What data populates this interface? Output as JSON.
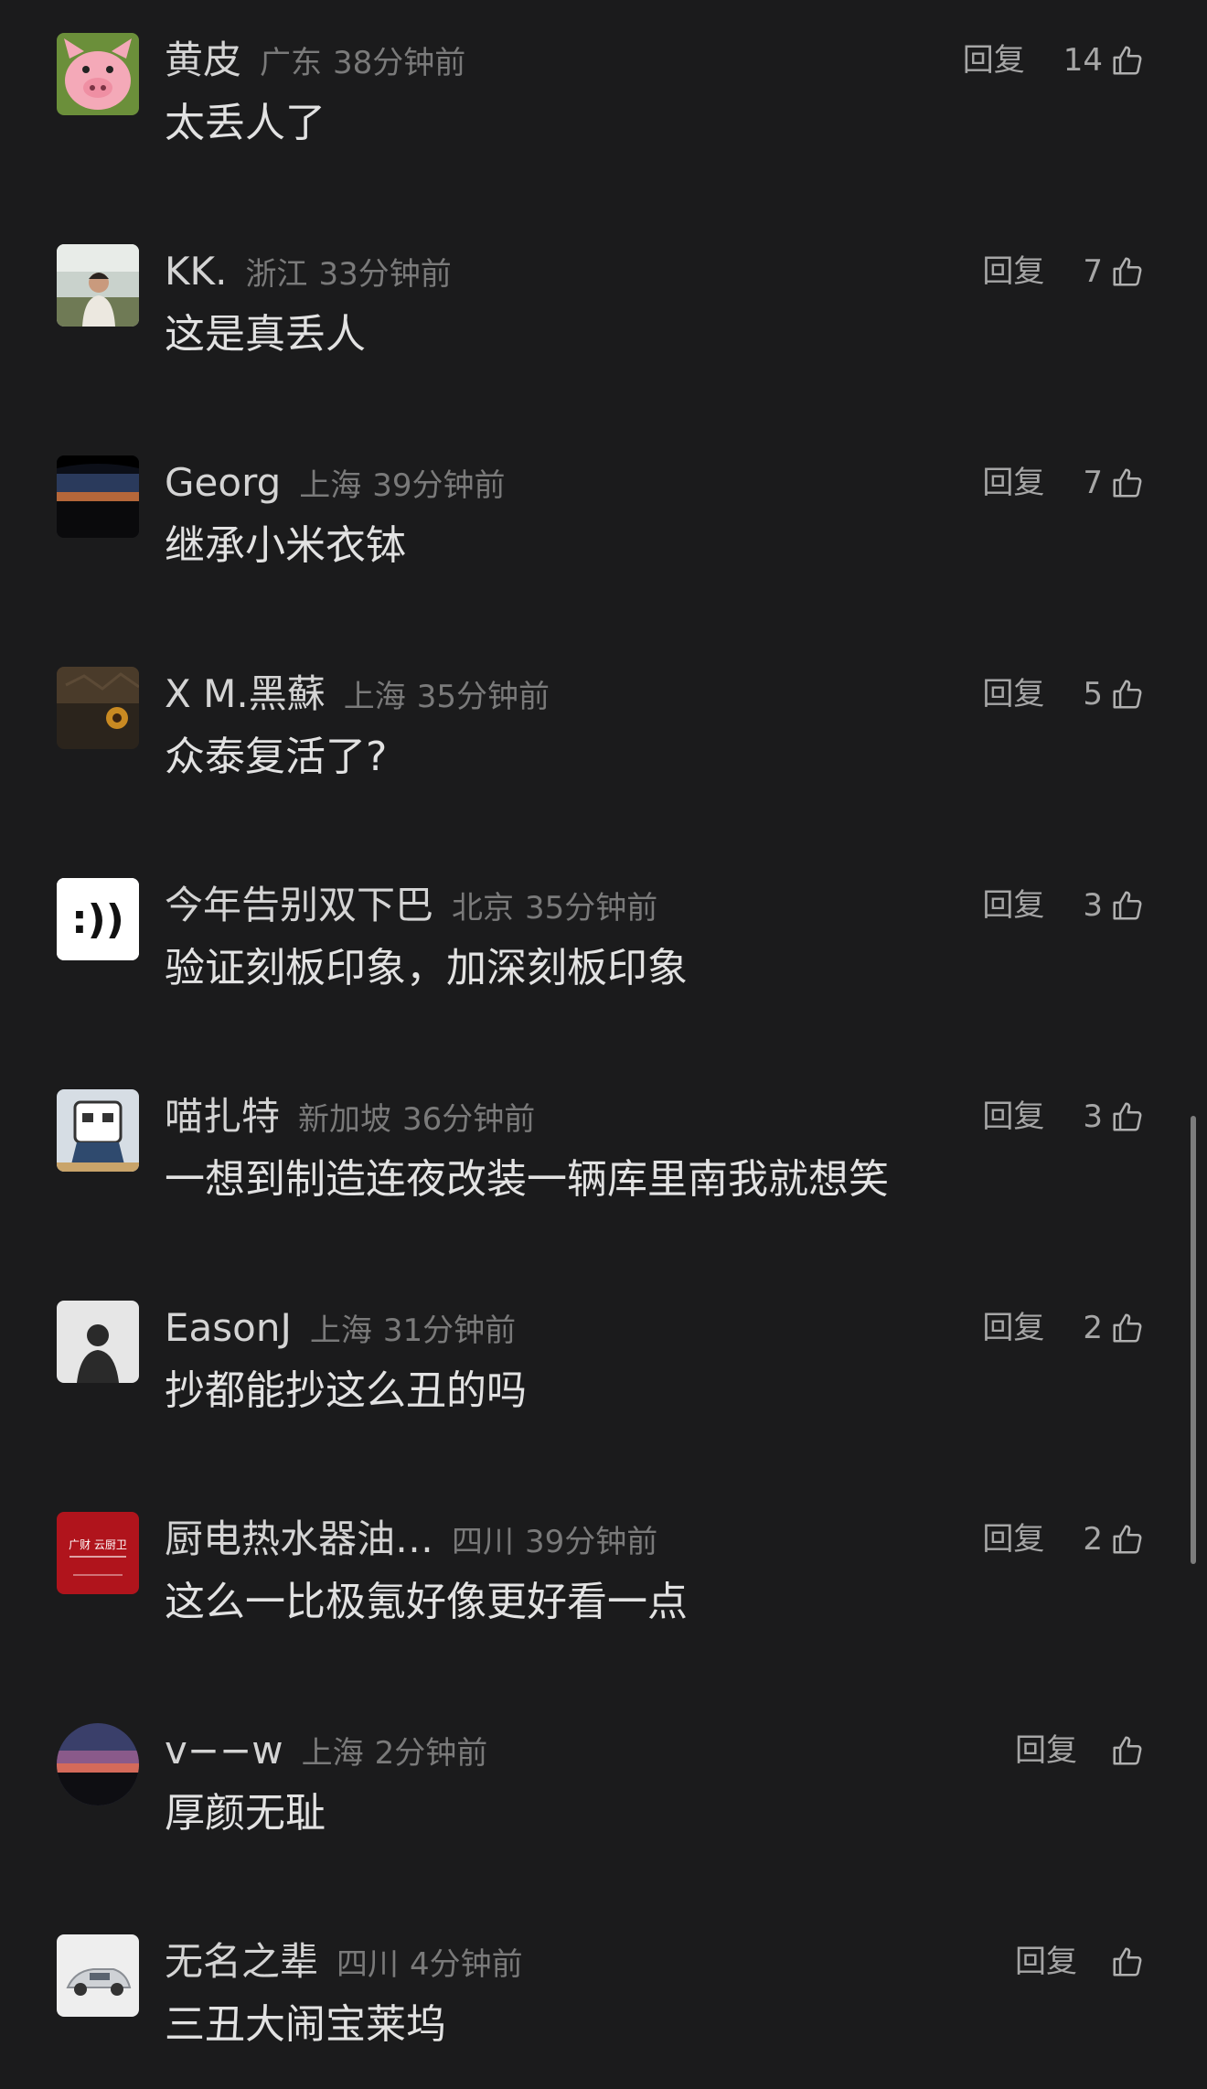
{
  "comments": [
    {
      "username": "黄皮",
      "location": "广东",
      "time": "38分钟前",
      "text": "太丢人了",
      "reply_label": "回复",
      "likes": "14",
      "avatar_icon": "pig-avatar-icon"
    },
    {
      "username": "KK.",
      "location": "浙江",
      "time": "33分钟前",
      "text": "这是真丢人",
      "reply_label": "回复",
      "likes": "7",
      "avatar_icon": "person-photo-avatar-icon"
    },
    {
      "username": "Georg",
      "location": "上海",
      "time": "39分钟前",
      "text": "继承小米衣钵",
      "reply_label": "回复",
      "likes": "7",
      "avatar_icon": "sunset-car-avatar-icon"
    },
    {
      "username": "X M.黑蘇",
      "location": "上海",
      "time": "35分钟前",
      "text": "众泰复活了?",
      "reply_label": "回复",
      "likes": "5",
      "avatar_icon": "sunflower-avatar-icon"
    },
    {
      "username": "今年告别双下巴",
      "location": "北京",
      "time": "35分钟前",
      "text": "验证刻板印象，加深刻板印象",
      "reply_label": "回复",
      "likes": "3",
      "avatar_icon": "smiley-avatar-icon",
      "avatar_text": ":))"
    },
    {
      "username": "喵扎特",
      "location": "新加坡",
      "time": "36分钟前",
      "text": "一想到制造连夜改装一辆库里南我就想笑",
      "reply_label": "回复",
      "likes": "3",
      "avatar_icon": "cartoon-avatar-icon"
    },
    {
      "username": "EasonJ",
      "location": "上海",
      "time": "31分钟前",
      "text": "抄都能抄这么丑的吗",
      "reply_label": "回复",
      "likes": "2",
      "avatar_icon": "silhouette-avatar-icon"
    },
    {
      "username": "厨电热水器油…",
      "location": "四川",
      "time": "39分钟前",
      "text": "这么一比极氪好像更好看一点",
      "reply_label": "回复",
      "likes": "2",
      "avatar_icon": "red-logo-avatar-icon",
      "avatar_text": "广财 云厨卫"
    },
    {
      "username": "v−−w",
      "location": "上海",
      "time": "2分钟前",
      "text": "厚颜无耻",
      "reply_label": "回复",
      "likes": "",
      "avatar_icon": "dusk-sky-avatar-icon"
    },
    {
      "username": "无名之辈",
      "location": "四川",
      "time": "4分钟前",
      "text": "三丑大闹宝莱坞",
      "reply_label": "回复",
      "likes": "",
      "avatar_icon": "white-car-avatar-icon"
    }
  ],
  "colors": {
    "background": "#1b1b1c",
    "username": "#d4d4d4",
    "meta": "#7a7a7a",
    "text": "#e2e2e2",
    "actions": "#a6a6a6"
  }
}
